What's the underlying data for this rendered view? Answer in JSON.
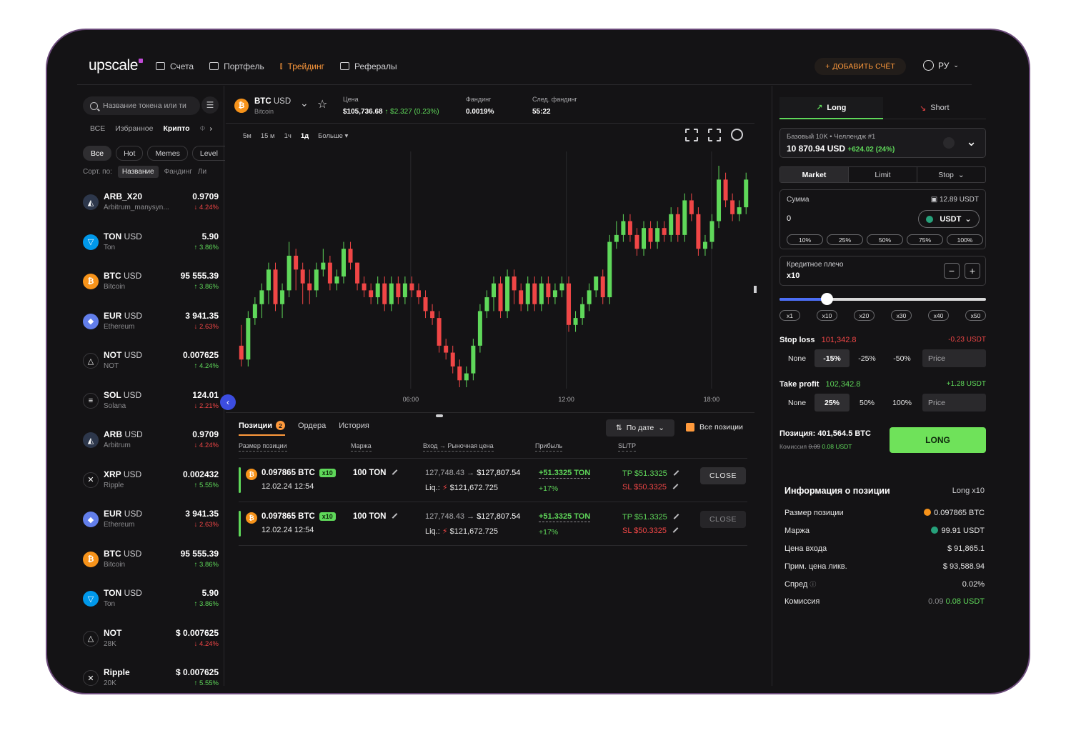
{
  "header": {
    "logo": "upscale",
    "nav": [
      {
        "label": "Счета",
        "icon": "wallet-icon"
      },
      {
        "label": "Портфель",
        "icon": "briefcase-icon"
      },
      {
        "label": "Трейдинг",
        "icon": "candles-icon",
        "active": true
      },
      {
        "label": "Рефералы",
        "icon": "gift-icon"
      }
    ],
    "add_account": "ДОБАВИТЬ СЧЁТ",
    "lang": "РУ"
  },
  "sidebar": {
    "search_placeholder": "Название токена или ти",
    "cat_tabs": [
      "ВСЕ",
      "Избранное",
      "Крипто",
      "Ф"
    ],
    "chips": [
      "Все",
      "Hot",
      "Memes",
      "Level"
    ],
    "sort_label": "Сорт. по:",
    "sort_options": [
      "Название",
      "Фандинг",
      "Ли"
    ],
    "tokens": [
      {
        "sym": "ARB_X20",
        "quote": "",
        "sub": "Arbitrum_manysyn...",
        "price": "0.9709",
        "change": "↓ 4.24%",
        "dir": "down",
        "icon": "arb"
      },
      {
        "sym": "TON",
        "quote": "USD",
        "sub": "Ton",
        "price": "5.90",
        "change": "↑ 3.86%",
        "dir": "up",
        "icon": "ton"
      },
      {
        "sym": "BTC",
        "quote": "USD",
        "sub": "Bitcoin",
        "price": "95 555.39",
        "change": "↑ 3.86%",
        "dir": "up",
        "icon": "btc"
      },
      {
        "sym": "EUR",
        "quote": "USD",
        "sub": "Ethereum",
        "price": "3 941.35",
        "change": "↓ 2.63%",
        "dir": "down",
        "icon": "eth"
      },
      {
        "sym": "NOT",
        "quote": "USD",
        "sub": "NOT",
        "price": "0.007625",
        "change": "↑ 4.24%",
        "dir": "up",
        "icon": "not"
      },
      {
        "sym": "SOL",
        "quote": "USD",
        "sub": "Solana",
        "price": "124.01",
        "change": "↓ 2.21%",
        "dir": "down",
        "icon": "sol"
      },
      {
        "sym": "ARB",
        "quote": "USD",
        "sub": "Arbitrum",
        "price": "0.9709",
        "change": "↓ 4.24%",
        "dir": "down",
        "icon": "arb"
      },
      {
        "sym": "XRP",
        "quote": "USD",
        "sub": "Ripple",
        "price": "0.002432",
        "change": "↑ 5.55%",
        "dir": "up",
        "icon": "xrp"
      },
      {
        "sym": "EUR",
        "quote": "USD",
        "sub": "Ethereum",
        "price": "3 941.35",
        "change": "↓ 2.63%",
        "dir": "down",
        "icon": "eth"
      },
      {
        "sym": "BTC",
        "quote": "USD",
        "sub": "Bitcoin",
        "price": "95 555.39",
        "change": "↑ 3.86%",
        "dir": "up",
        "icon": "btc"
      },
      {
        "sym": "TON",
        "quote": "USD",
        "sub": "Ton",
        "price": "5.90",
        "change": "↑ 3.86%",
        "dir": "up",
        "icon": "ton"
      },
      {
        "sym": "NOT",
        "quote": "",
        "sub": "28K",
        "price": "$ 0.007625",
        "change": "↓ 4.24%",
        "dir": "down",
        "icon": "not"
      },
      {
        "sym": "Ripple",
        "quote": "",
        "sub": "20K",
        "price": "$ 0.007625",
        "change": "↑ 5.55%",
        "dir": "up",
        "icon": "xrp"
      }
    ]
  },
  "ticker": {
    "symbol": "BTC",
    "quote": "USD",
    "name": "Bitcoin",
    "price_label": "Цена",
    "price": "$105,736.68",
    "price_change": "↑ $2.327 (0.23%)",
    "funding_label": "Фандинг",
    "funding": "0.0019%",
    "next_funding_label": "След. фандинг",
    "next_funding": "55:22"
  },
  "timeframes": [
    "5м",
    "15 м",
    "1ч",
    "1д",
    "Больше"
  ],
  "active_timeframe": "1д",
  "chart_data": {
    "type": "candlestick",
    "x_ticks": [
      "06:00",
      "12:00",
      "18:00"
    ],
    "candles": [
      [
        52,
        50,
        55,
        49
      ],
      [
        50,
        56,
        57,
        49
      ],
      [
        56,
        58,
        59,
        55
      ],
      [
        58,
        60,
        61,
        56
      ],
      [
        60,
        63,
        64,
        58
      ],
      [
        63,
        58,
        64,
        57
      ],
      [
        58,
        60,
        61,
        56
      ],
      [
        60,
        65,
        67,
        59
      ],
      [
        65,
        63,
        66,
        60
      ],
      [
        63,
        61,
        64,
        58
      ],
      [
        61,
        60,
        63,
        58
      ],
      [
        60,
        63,
        64,
        59
      ],
      [
        63,
        64,
        66,
        62
      ],
      [
        64,
        61,
        65,
        60
      ],
      [
        61,
        62,
        63,
        60
      ],
      [
        62,
        66,
        67,
        61
      ],
      [
        66,
        64,
        67,
        63
      ],
      [
        64,
        61,
        64,
        60
      ],
      [
        61,
        60,
        62,
        59
      ],
      [
        60,
        59,
        61,
        58
      ],
      [
        59,
        61,
        62,
        58
      ],
      [
        61,
        58,
        62,
        57
      ],
      [
        58,
        61,
        62,
        57
      ],
      [
        61,
        59,
        62,
        58
      ],
      [
        59,
        61,
        62,
        58
      ],
      [
        61,
        60,
        62,
        59
      ],
      [
        60,
        59,
        61,
        58
      ],
      [
        59,
        57,
        60,
        56
      ],
      [
        57,
        56,
        58,
        55
      ],
      [
        56,
        52,
        57,
        51
      ],
      [
        52,
        51,
        53,
        50
      ],
      [
        51,
        49,
        52,
        48
      ],
      [
        49,
        47,
        50,
        46
      ],
      [
        47,
        48,
        49,
        46
      ],
      [
        48,
        52,
        53,
        47
      ],
      [
        52,
        57,
        58,
        51
      ],
      [
        57,
        59,
        60,
        56
      ],
      [
        59,
        61,
        62,
        57
      ],
      [
        61,
        57,
        62,
        56
      ],
      [
        57,
        62,
        63,
        56
      ],
      [
        62,
        60,
        63,
        58
      ],
      [
        60,
        58,
        61,
        57
      ],
      [
        58,
        61,
        62,
        57
      ],
      [
        61,
        58,
        62,
        57
      ],
      [
        58,
        61,
        62,
        57
      ],
      [
        61,
        59,
        62,
        58
      ],
      [
        59,
        60,
        61,
        58
      ],
      [
        60,
        61,
        62,
        59
      ],
      [
        61,
        55,
        62,
        54
      ],
      [
        55,
        56,
        57,
        54
      ],
      [
        56,
        58,
        59,
        55
      ],
      [
        58,
        60,
        61,
        57
      ],
      [
        60,
        62,
        62,
        59
      ],
      [
        62,
        59,
        63,
        58
      ],
      [
        59,
        67,
        68,
        58
      ],
      [
        67,
        68,
        70,
        66
      ],
      [
        68,
        70,
        71,
        67
      ],
      [
        70,
        68,
        71,
        67
      ],
      [
        68,
        66,
        69,
        65
      ],
      [
        66,
        69,
        70,
        65
      ],
      [
        69,
        67,
        70,
        66
      ],
      [
        67,
        69,
        70,
        66
      ],
      [
        69,
        68,
        70,
        67
      ],
      [
        68,
        71,
        72,
        67
      ],
      [
        71,
        68,
        72,
        67
      ],
      [
        68,
        73,
        74,
        67
      ],
      [
        73,
        71,
        74,
        70
      ],
      [
        71,
        66,
        72,
        65
      ],
      [
        66,
        67,
        68,
        65
      ],
      [
        67,
        70,
        71,
        66
      ],
      [
        70,
        76,
        78,
        69
      ],
      [
        76,
        73,
        77,
        72
      ],
      [
        73,
        71,
        74,
        70
      ],
      [
        71,
        72,
        73,
        70
      ],
      [
        72,
        76,
        77,
        71
      ]
    ]
  },
  "positions": {
    "tabs": [
      {
        "label": "Позиции",
        "badge": "2"
      },
      {
        "label": "Ордера"
      },
      {
        "label": "История"
      }
    ],
    "sort": "По дате",
    "all_positions": "Все позиции",
    "columns": [
      "Размер позиции",
      "Маржа",
      "Вход → Рыночная цена",
      "Прибыль",
      "SL/TP"
    ],
    "rows": [
      {
        "size": "0.097865 BTC",
        "lev": "x10",
        "date": "12.02.24 12:54",
        "margin": "100 TON",
        "entry": "127,748.43 →",
        "market": "$127,807.54",
        "liq_label": "Liq.:",
        "liq": "$121,672.725",
        "profit": "+51.3325 TON",
        "profit_pct": "+17%",
        "tp": "TP $51.3325",
        "sl": "SL $50.3325",
        "close": "CLOSE"
      },
      {
        "size": "0.097865 BTC",
        "lev": "x10",
        "date": "12.02.24 12:54",
        "margin": "100 TON",
        "entry": "127,748.43 →",
        "market": "$127,807.54",
        "liq_label": "Liq.:",
        "liq": "$121,672.725",
        "profit": "+51.3325 TON",
        "profit_pct": "+17%",
        "tp": "TP $51.3325",
        "sl": "SL $50.3325",
        "close": "CLOSE"
      }
    ]
  },
  "order": {
    "long": "Long",
    "short": "Short",
    "account_name": "Базовый 10K • Челлендж #1",
    "account_balance": "10 870.94 USD",
    "account_pnl": "+624.02 (24%)",
    "types": [
      "Market",
      "Limit",
      "Stop"
    ],
    "sum_label": "Сумма",
    "available": "12.89 USDT",
    "amount": "0",
    "currency": "USDT",
    "pct_buttons": [
      "10%",
      "25%",
      "50%",
      "75%",
      "100%"
    ],
    "leverage_label": "Кредитное плечо",
    "leverage": "x10",
    "leverage_marks": [
      "x1",
      "x10",
      "x20",
      "x30",
      "x40",
      "x50"
    ],
    "leverage_level": 0.2,
    "stop_loss_label": "Stop loss",
    "stop_loss_value": "101,342.8",
    "stop_loss_pnl": "-0.23 USDT",
    "sl_options": [
      "None",
      "-15%",
      "-25%",
      "-50%"
    ],
    "sl_active": "-15%",
    "take_profit_label": "Take profit",
    "take_profit_value": "102,342.8",
    "take_profit_pnl": "+1.28 USDT",
    "tp_options": [
      "None",
      "25%",
      "50%",
      "100%"
    ],
    "tp_active": "25%",
    "price_placeholder": "Price",
    "position_summary": "Позиция: 401,564.5 BTC",
    "commission_label": "Комиссия",
    "commission_old": "0.09",
    "commission_new": "0.08 USDT",
    "submit": "LONG"
  },
  "position_info": {
    "title": "Информация о позиции",
    "mode": "Long x10",
    "rows": [
      {
        "label": "Размер позиции",
        "value": "0.097865 BTC"
      },
      {
        "label": "Маржа",
        "value": "99.91 USDT"
      },
      {
        "label": "Цена входа",
        "value": "$ 91,865.1"
      },
      {
        "label": "Прим. цена ликв.",
        "value": "$ 93,588.94"
      },
      {
        "label": "Спред",
        "value": "0.02%"
      },
      {
        "label": "Комиссия",
        "value_old": "0.09",
        "value": "0.08 USDT"
      }
    ]
  },
  "colors": {
    "accent": "#ff9a3c",
    "up": "#5fd85a",
    "down": "#f04646",
    "bg": "#141315"
  }
}
